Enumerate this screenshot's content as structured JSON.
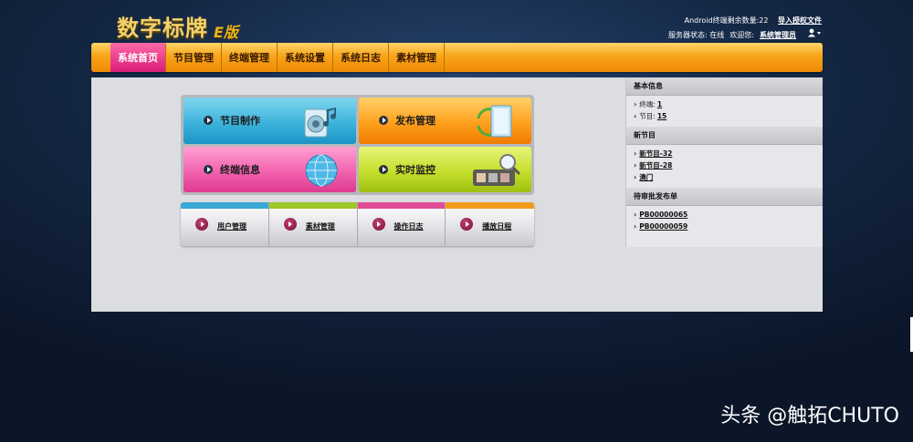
{
  "header": {
    "logo_text": "数字标牌",
    "logo_badge": "E版",
    "terminal_count_label": "Android终端剩余数量:22",
    "import_license_link": "导入授权文件",
    "server_status": "服务器状态: 在线",
    "welcome_text": "欢迎您:",
    "admin_link": "系统管理员"
  },
  "nav": {
    "items": [
      "系统首页",
      "节目管理",
      "终端管理",
      "系统设置",
      "系统日志",
      "素材管理"
    ],
    "active_index": 0
  },
  "tiles": [
    {
      "label": "节目制作",
      "color": "#3db3dc",
      "icon": "speaker-music-icon"
    },
    {
      "label": "发布管理",
      "color": "#ffa01d",
      "icon": "publish-screen-icon"
    },
    {
      "label": "终端信息",
      "color": "#f263ae",
      "icon": "globe-icon"
    },
    {
      "label": "实时监控",
      "color": "#c6de2c",
      "icon": "monitor-magnifier-icon"
    }
  ],
  "subtiles": [
    {
      "label": "用户管理",
      "bar_color": "#3aa9d6"
    },
    {
      "label": "素材管理",
      "bar_color": "#9dc72b"
    },
    {
      "label": "操作日志",
      "bar_color": "#e04a95"
    },
    {
      "label": "播放日程",
      "bar_color": "#f39a1e"
    }
  ],
  "sidebar": {
    "basic_info": {
      "title": "基本信息",
      "terminal_label": "终端:",
      "terminal_value": "1",
      "program_label": "节目:",
      "program_value": "15"
    },
    "new_programs": {
      "title": "新节目",
      "items": [
        "新节目-32",
        "新节目-28",
        "澳门"
      ]
    },
    "pending": {
      "title": "待审批发布单",
      "items": [
        "PB00000065",
        "PB00000059"
      ]
    }
  },
  "watermark": "头条 @触拓CHUTO"
}
